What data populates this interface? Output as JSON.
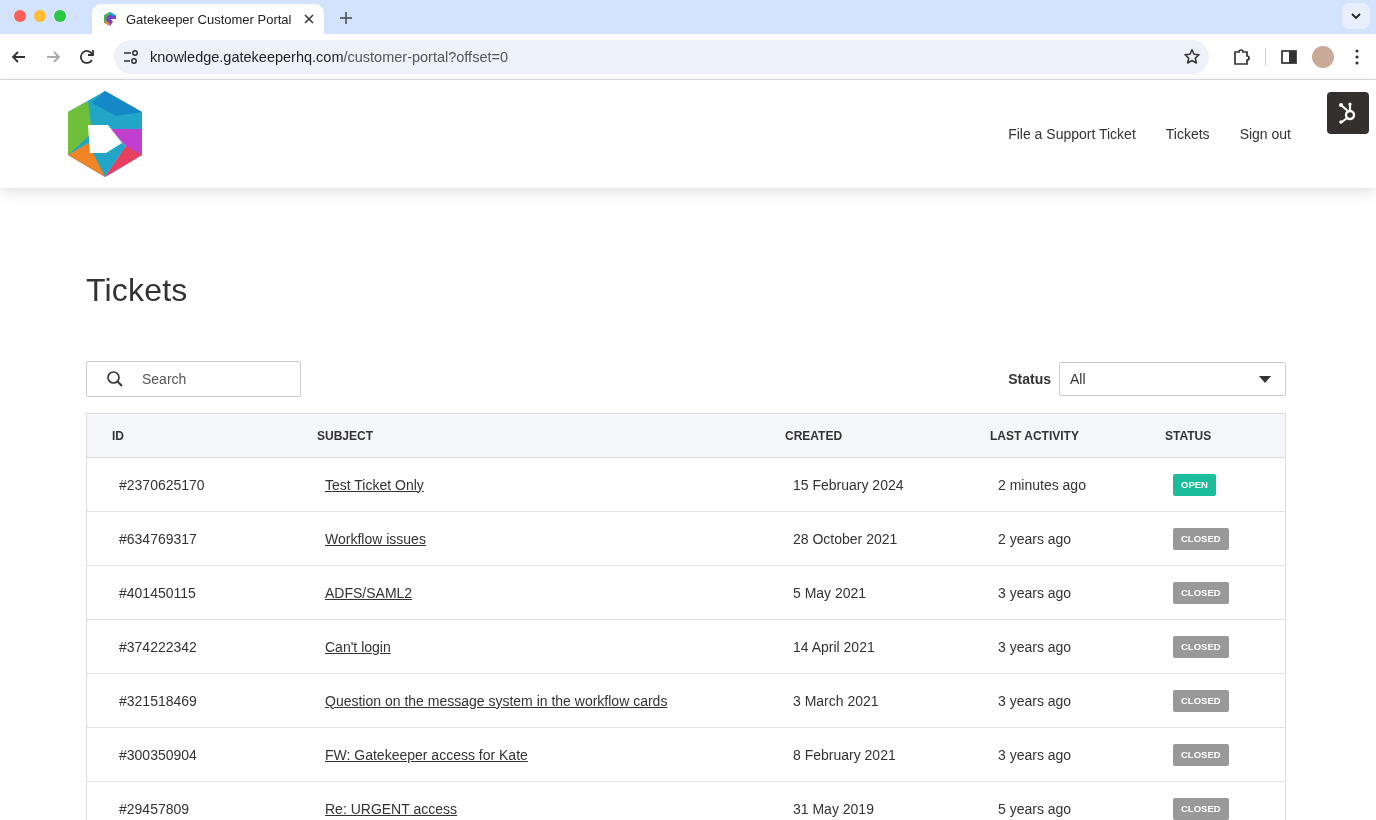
{
  "browser": {
    "tab_title": "Gatekeeper Customer Portal",
    "url_host": "knowledge.gatekeeperhq.com",
    "url_path": "/customer-portal?offset=0"
  },
  "nav": {
    "links": [
      "File a Support Ticket",
      "Tickets",
      "Sign out"
    ]
  },
  "page": {
    "title": "Tickets",
    "search": {
      "placeholder": "Search"
    },
    "status_filter": {
      "label": "Status",
      "value": "All"
    }
  },
  "table": {
    "columns": [
      "ID",
      "SUBJECT",
      "CREATED",
      "LAST ACTIVITY",
      "STATUS"
    ],
    "rows": [
      {
        "id": "#2370625170",
        "subject": "Test Ticket Only",
        "created": "15 February 2024",
        "last_activity": "2 minutes ago",
        "status": "OPEN",
        "color": "#1abc9c"
      },
      {
        "id": "#634769317",
        "subject": "Workflow issues",
        "created": "28 October 2021",
        "last_activity": "2 years ago",
        "status": "CLOSED",
        "color": "#999999"
      },
      {
        "id": "#401450115",
        "subject": "ADFS/SAML2",
        "created": "5 May 2021",
        "last_activity": "3 years ago",
        "status": "CLOSED",
        "color": "#999999"
      },
      {
        "id": "#374222342",
        "subject": "Can't login",
        "created": "14 April 2021",
        "last_activity": "3 years ago",
        "status": "CLOSED",
        "color": "#999999"
      },
      {
        "id": "#321518469",
        "subject": "Question on the message system in the workflow cards",
        "created": "3 March 2021",
        "last_activity": "3 years ago",
        "status": "CLOSED",
        "color": "#999999"
      },
      {
        "id": "#300350904",
        "subject": "FW: Gatekeeper access for Kate",
        "created": "8 February 2021",
        "last_activity": "3 years ago",
        "status": "CLOSED",
        "color": "#999999"
      },
      {
        "id": "#29457809",
        "subject": "Re: URGENT access",
        "created": "31 May 2019",
        "last_activity": "5 years ago",
        "status": "CLOSED",
        "color": "#999999"
      }
    ]
  }
}
